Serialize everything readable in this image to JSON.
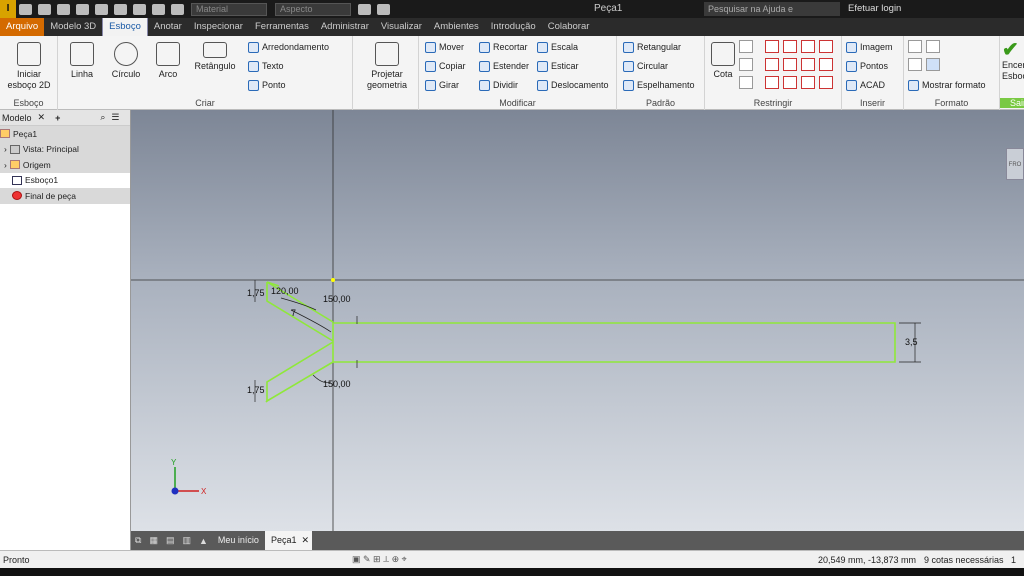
{
  "qat": {
    "app_logo": "I",
    "material": "Material",
    "appearance": "Aspecto",
    "title": "Peça1",
    "search_placeholder": "Pesquisar na Ajuda e comandos...",
    "login": "Efetuar login"
  },
  "tabs": [
    "Arquivo",
    "Modelo 3D",
    "Esboço",
    "Anotar",
    "Inspecionar",
    "Ferramentas",
    "Administrar",
    "Visualizar",
    "Ambientes",
    "Introdução",
    "Colaborar"
  ],
  "ribbon": {
    "esboco": {
      "label": "Esboço",
      "start": "Iniciar esboço 2D"
    },
    "criar": {
      "label": "Criar",
      "linha": "Linha",
      "circulo": "Círculo",
      "arco": "Arco",
      "retangulo": "Retângulo",
      "arred": "Arredondamento",
      "texto": "Texto",
      "ponto": "Ponto"
    },
    "projetar": {
      "label": "Projetar geometria"
    },
    "modificar": {
      "label": "Modificar",
      "mover": "Mover",
      "copiar": "Copiar",
      "girar": "Girar",
      "recortar": "Recortar",
      "estender": "Estender",
      "dividir": "Dividir",
      "escala": "Escala",
      "esticar": "Esticar",
      "deslocamento": "Deslocamento"
    },
    "padrao": {
      "label": "Padrão",
      "retangular": "Retangular",
      "circular": "Circular",
      "espelhamento": "Espelhamento"
    },
    "restringir": {
      "label": "Restringir",
      "cota": "Cota"
    },
    "inserir": {
      "label": "Inserir",
      "imagem": "Imagem",
      "pontos": "Pontos",
      "acad": "ACAD"
    },
    "formato": {
      "label": "Formato",
      "mostrar": "Mostrar formato"
    },
    "sair": {
      "label": "Sair",
      "finish": "Encerrar Esboço"
    }
  },
  "browser": {
    "tab": "Modelo",
    "items": [
      "Peça1",
      "Vista: Principal",
      "Origem",
      "Esboço1",
      "Final de peça"
    ]
  },
  "sketch": {
    "dims": [
      "120,00",
      "150,00",
      "150,00",
      "1,75",
      "1,75",
      "3,5",
      "7"
    ]
  },
  "bottom_tabs": [
    "Meu início",
    "Peça1"
  ],
  "status": {
    "left": "Pronto",
    "coords": "20,549 mm, -13,873 mm",
    "dims_needed": "9 cotas necessárias",
    "page": "1"
  },
  "colors": {
    "file_tab": "#d46a00",
    "sketch_line": "#8fe83a",
    "axis_x": "#d02020",
    "axis_y": "#20a020",
    "axis_z": "#2030c0"
  }
}
